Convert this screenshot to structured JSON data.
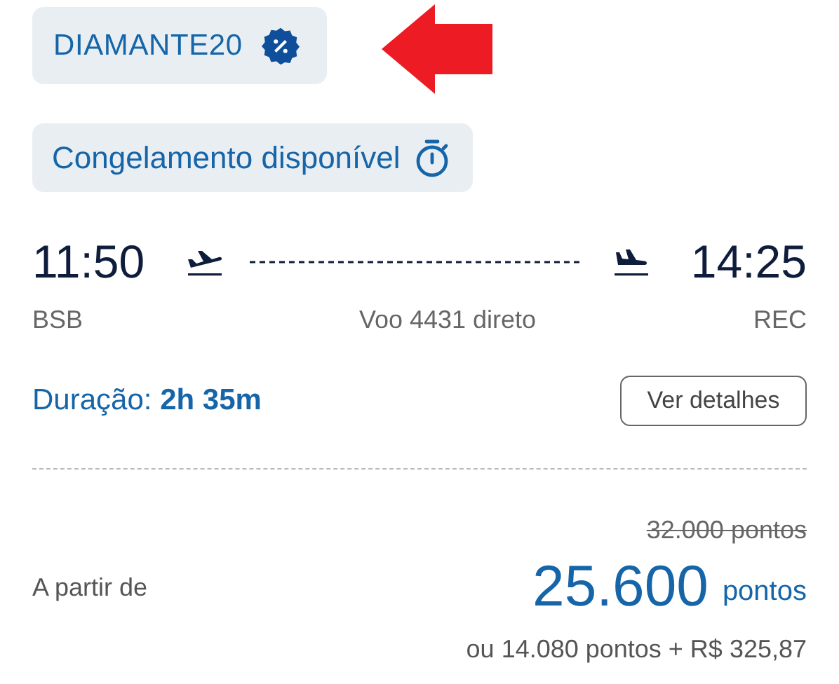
{
  "promo_badge": {
    "label": "DIAMANTE20"
  },
  "freeze_badge": {
    "label": "Congelamento disponível"
  },
  "flight": {
    "departure_time": "11:50",
    "arrival_time": "14:25",
    "origin": "BSB",
    "destination": "REC",
    "flight_info": "Voo 4431 direto",
    "duration_label": "Duração:",
    "duration": "2h 35m",
    "details_button": "Ver detalhes"
  },
  "price": {
    "from_label": "A partir de",
    "original": "32.000 pontos",
    "amount": "25.600",
    "unit": "pontos",
    "alternative": "ou 14.080 pontos + R$ 325,87"
  }
}
